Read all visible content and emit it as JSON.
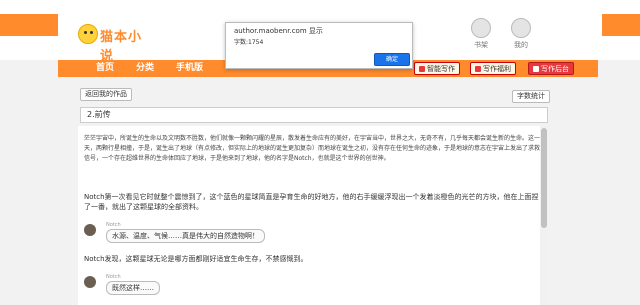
{
  "header": {
    "logo_text": "猫本小说",
    "links": [
      {
        "label": "书架"
      },
      {
        "label": "我的"
      }
    ]
  },
  "nav": {
    "items": [
      {
        "label": "首页"
      },
      {
        "label": "分类"
      },
      {
        "label": "手机版"
      }
    ],
    "buttons": [
      {
        "label": "智能写作"
      },
      {
        "label": "写作福利"
      },
      {
        "label": "写作后台"
      }
    ]
  },
  "page": {
    "back_label": "返回我的作品",
    "count_label": "字数统计",
    "chapter_title": "2.前传"
  },
  "dialog": {
    "title": "author.maobenr.com 显示",
    "message": "字数:1754",
    "ok_label": "确定"
  },
  "article": {
    "paragraph1": "茫茫宇宙中，所诞生的生命以及文明数不胜数，他们就像一颗颗闪耀的星辰，散发着生命应有的美好，在宇宙当中，世界之大，无奇不有，几乎每天都会诞生新的生命。这一天，两颗行星相撞，于是，诞生出了地球（有点修改，但实际上的地球的诞生更加复杂）而地球在诞生之初，没有存在任何生命的迹象，于是地球的意志在宇宙上发出了求救信号，一个存在超维世界的生命体回应了地球，于是他来到了地球，他的名字是Notch，也就是这个世界的创世神。",
    "paragraph2": "Notch第一次看见它时就整个震惊到了，这个蓝色的星球简直是孕育生命的好地方，他的右手缓缓浮现出一个发着淡橙色的光芒的方块，他在上面捏了一番，就出了这颗星球的全部资料。",
    "bubble1_name": "Notch",
    "bubble1_text": "水源、温度、气候……真是伟大的自然造物啊！",
    "paragraph3": "Notch发现，这颗星球无论是哪方面都刚好适宜生命生存，不禁感慨到。",
    "bubble2_name": "Notch",
    "bubble2_text": "既然这样……"
  },
  "colors": {
    "brand_orange": "#ff8b2c",
    "accent_red": "#e8383d",
    "dialog_button": "#1a73e8"
  }
}
